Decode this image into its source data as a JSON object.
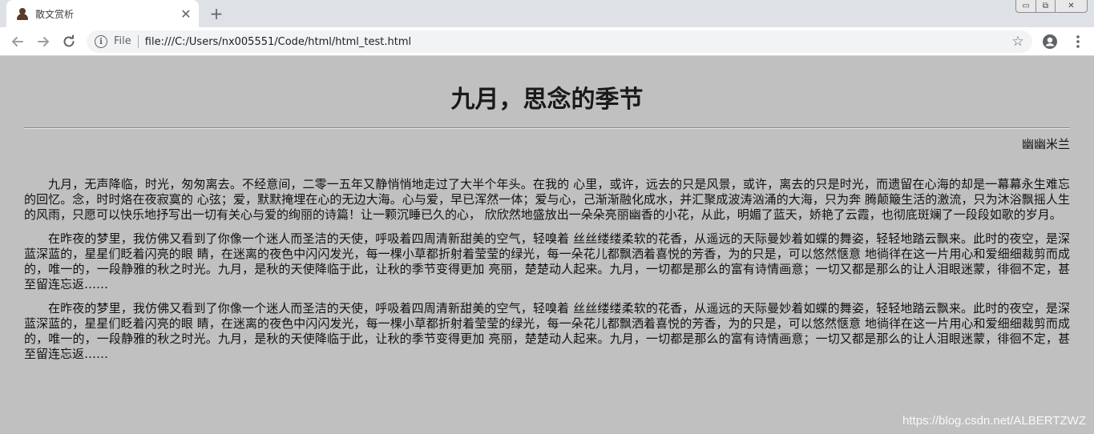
{
  "browser": {
    "tab": {
      "title": "散文赏析",
      "close_glyph": "✕"
    },
    "new_tab_glyph": "+",
    "window_controls": {
      "minimize_glyph": "▭",
      "restore_glyph": "⧉",
      "close_glyph": "✕"
    },
    "omnibox": {
      "scheme_label": "File",
      "url": "file:///C:/Users/nx005551/Code/html/html_test.html"
    },
    "star_glyph": "☆"
  },
  "article": {
    "title": "九月，思念的季节",
    "author": "幽幽米兰",
    "paragraphs": [
      "九月，无声降临，时光，匆匆离去。不经意间，二零一五年又静悄悄地走过了大半个年头。在我的 心里，或许，远去的只是风景，或许，离去的只是时光，而遗留在心海的却是一幕幕永生难忘的回忆。念，时时烙在夜寂寞的 心弦；爱，默默掩埋在心的无边大海。心与爱，早已浑然一体；爱与心，己渐渐融化成水，并汇聚成波涛汹涌的大海，只为奔 腾颠簸生活的激流，只为沐浴飘摇人生的风雨，只愿可以快乐地抒写出一切有关心与爱的绚丽的诗篇！让一颗沉睡已久的心， 欣欣然地盛放出一朵朵亮丽幽香的小花，从此，明媚了蓝天，娇艳了云霞，也彻底斑斓了一段段如歌的岁月。",
      "在昨夜的梦里，我仿佛又看到了你像一个迷人而圣洁的天使，呼吸着四周清新甜美的空气，轻嗅着 丝丝缕缕柔软的花香，从遥远的天际曼妙着如蝶的舞姿，轻轻地踏云飘来。此时的夜空，是深蓝深蓝的，星星们眨着闪亮的眼 睛，在迷离的夜色中闪闪发光，每一棵小草都折射着莹莹的绿光，每一朵花儿都飘洒着喜悦的芳香，为的只是，可以悠然惬意 地徜徉在这一片用心和爱细细裁剪而成的，唯一的，一段静雅的秋之时光。九月，是秋的天使降临于此，让秋的季节变得更加 亮丽，楚楚动人起来。九月，一切都是那么的富有诗情画意；一切又都是那么的让人泪眼迷蒙，徘徊不定，甚至留连忘返……",
      "在昨夜的梦里，我仿佛又看到了你像一个迷人而圣洁的天使，呼吸着四周清新甜美的空气，轻嗅着 丝丝缕缕柔软的花香，从遥远的天际曼妙着如蝶的舞姿，轻轻地踏云飘来。此时的夜空，是深蓝深蓝的，星星们眨着闪亮的眼 睛，在迷离的夜色中闪闪发光，每一棵小草都折射着莹莹的绿光，每一朵花儿都飘洒着喜悦的芳香，为的只是，可以悠然惬意 地徜徉在这一片用心和爱细细裁剪而成的，唯一的，一段静雅的秋之时光。九月，是秋的天使降临于此，让秋的季节变得更加 亮丽，楚楚动人起来。九月，一切都是那么的富有诗情画意；一切又都是那么的让人泪眼迷蒙，徘徊不定，甚至留连忘返……"
    ]
  },
  "watermark": "https://blog.csdn.net/ALBERTZWZ",
  "colors": {
    "page_background": "#c0c0c0",
    "tabbar_background": "#dee1e6",
    "text": "#111111"
  }
}
